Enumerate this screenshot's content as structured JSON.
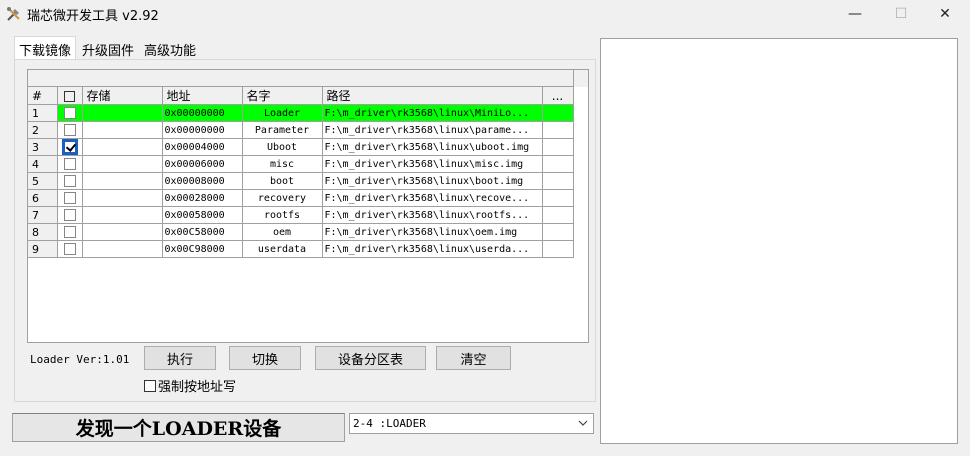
{
  "window": {
    "title": "瑞芯微开发工具 v2.92",
    "minimize_glyph": "—",
    "maximize_glyph": "☐",
    "close_glyph": "✕",
    "icon": "tools-icon"
  },
  "tabs": [
    {
      "label": "下载镜像",
      "active": true
    },
    {
      "label": "升级固件",
      "active": false
    },
    {
      "label": "高级功能",
      "active": false
    }
  ],
  "table": {
    "headers": {
      "index": "#",
      "check": "",
      "storage": "存储",
      "address": "地址",
      "name": "名字",
      "path": "路径",
      "more": "..."
    },
    "rows": [
      {
        "index": "1",
        "checked": false,
        "storage": "",
        "address": "0x00000000",
        "name": "Loader",
        "path": "F:\\m_driver\\rk3568\\linux\\MiniLo...",
        "selected": true
      },
      {
        "index": "2",
        "checked": false,
        "storage": "",
        "address": "0x00000000",
        "name": "Parameter",
        "path": "F:\\m_driver\\rk3568\\linux\\parame...",
        "selected": false
      },
      {
        "index": "3",
        "checked": true,
        "storage": "",
        "address": "0x00004000",
        "name": "Uboot",
        "path": "F:\\m_driver\\rk3568\\linux\\uboot.img",
        "selected": false
      },
      {
        "index": "4",
        "checked": false,
        "storage": "",
        "address": "0x00006000",
        "name": "misc",
        "path": "F:\\m_driver\\rk3568\\linux\\misc.img",
        "selected": false
      },
      {
        "index": "5",
        "checked": false,
        "storage": "",
        "address": "0x00008000",
        "name": "boot",
        "path": "F:\\m_driver\\rk3568\\linux\\boot.img",
        "selected": false
      },
      {
        "index": "6",
        "checked": false,
        "storage": "",
        "address": "0x00028000",
        "name": "recovery",
        "path": "F:\\m_driver\\rk3568\\linux\\recove...",
        "selected": false
      },
      {
        "index": "7",
        "checked": false,
        "storage": "",
        "address": "0x00058000",
        "name": "rootfs",
        "path": "F:\\m_driver\\rk3568\\linux\\rootfs...",
        "selected": false
      },
      {
        "index": "8",
        "checked": false,
        "storage": "",
        "address": "0x00C58000",
        "name": "oem",
        "path": "F:\\m_driver\\rk3568\\linux\\oem.img",
        "selected": false
      },
      {
        "index": "9",
        "checked": false,
        "storage": "",
        "address": "0x00C98000",
        "name": "userdata",
        "path": "F:\\m_driver\\rk3568\\linux\\userda...",
        "selected": false
      }
    ]
  },
  "loader_version": "Loader Ver:1.01",
  "buttons": {
    "execute": "执行",
    "switch": "切换",
    "partition_table": "设备分区表",
    "clear": "清空"
  },
  "force_write": {
    "label": "强制按地址写",
    "checked": false
  },
  "status_text": "发现一个LOADER设备",
  "device_select": {
    "value": "2-4 :LOADER"
  },
  "colors": {
    "selected_row": "#00ff00",
    "window_bg": "#f0f0f0"
  }
}
